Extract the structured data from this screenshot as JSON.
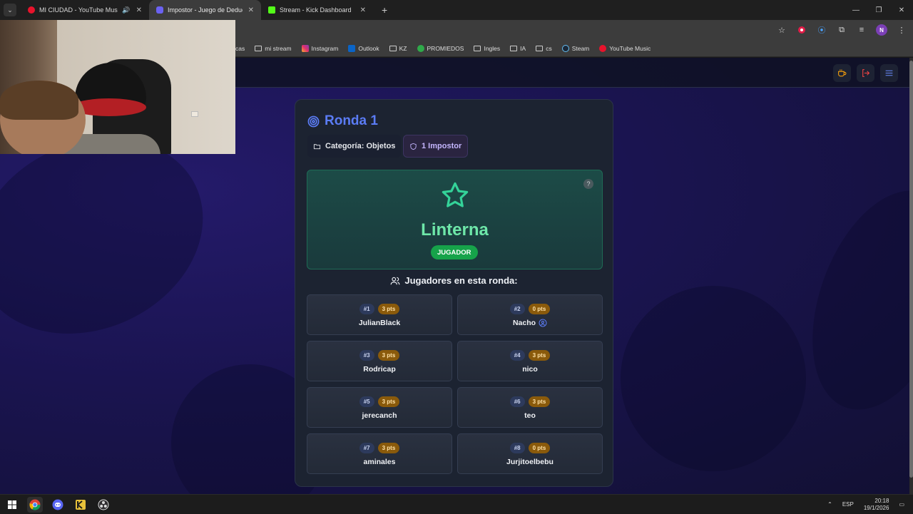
{
  "browser": {
    "tabs": [
      {
        "title": "MI CIUDAD - YouTube Music",
        "favicon_color": "#e8132c",
        "audio": true,
        "active": false
      },
      {
        "title": "Impostor - Juego de Deducción",
        "favicon_color": "#6b62f2",
        "audio": false,
        "active": true
      },
      {
        "title": "Stream - Kick Dashboard",
        "favicon_color": "#53fc18",
        "audio": false,
        "active": false
      }
    ],
    "new_tab_icon": "+",
    "window_controls": [
      "minimize",
      "restore",
      "close"
    ],
    "bookmarks": [
      {
        "label": "cas",
        "icon": "folder-icon"
      },
      {
        "label": "mi stream",
        "icon": "folder-icon"
      },
      {
        "label": "Instagram",
        "icon": "instagram-icon"
      },
      {
        "label": "Outlook",
        "icon": "outlook-icon"
      },
      {
        "label": "KZ",
        "icon": "folder-icon"
      },
      {
        "label": "PROMIEDOS",
        "icon": "promiedos-icon"
      },
      {
        "label": "Ingles",
        "icon": "folder-icon"
      },
      {
        "label": "IA",
        "icon": "folder-icon"
      },
      {
        "label": "cs",
        "icon": "folder-icon"
      },
      {
        "label": "Steam",
        "icon": "steam-icon"
      },
      {
        "label": "YouTube Music",
        "icon": "youtube-music-icon"
      }
    ],
    "profile_initial": "N"
  },
  "game": {
    "round_title": "Ronda 1",
    "category_label": "Categoría: Objetos",
    "impostor_label": "1 Impostor",
    "secret_word": "Linterna",
    "role": "JUGADOR",
    "help_icon": "?",
    "players_heading": "Jugadores en esta ronda:",
    "players": [
      {
        "number": "#1",
        "points": "3 pts",
        "name": "JulianBlack",
        "is_you": false
      },
      {
        "number": "#2",
        "points": "0 pts",
        "name": "Nacho",
        "is_you": true
      },
      {
        "number": "#3",
        "points": "3 pts",
        "name": "Rodricap",
        "is_you": false
      },
      {
        "number": "#4",
        "points": "3 pts",
        "name": "nico",
        "is_you": false
      },
      {
        "number": "#5",
        "points": "3 pts",
        "name": "jerecanch",
        "is_you": false
      },
      {
        "number": "#6",
        "points": "3 pts",
        "name": "teo",
        "is_you": false
      },
      {
        "number": "#7",
        "points": "3 pts",
        "name": "aminales",
        "is_you": false
      },
      {
        "number": "#8",
        "points": "0 pts",
        "name": "Jurjitoelbebu",
        "is_you": false
      }
    ],
    "colors": {
      "accent": "#5b7cf6",
      "word": "#6ee7a9",
      "role_badge": "#16a34a",
      "points_badge": "#8a5a0b"
    }
  },
  "taskbar": {
    "apps": [
      "windows-start-icon",
      "chrome-icon",
      "discord-icon",
      "kick-icon",
      "obs-icon"
    ],
    "language": "ESP",
    "time": "20:18",
    "date": "19/1/2026"
  }
}
